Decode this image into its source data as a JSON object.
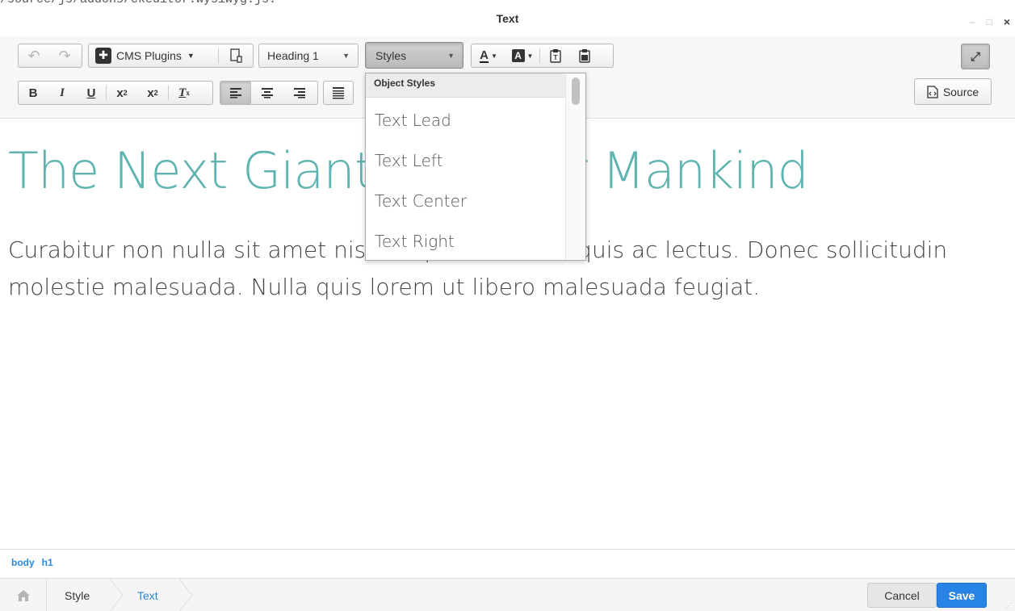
{
  "path_fragment": "/source/js/addons/ckeditor.wysiwyg.js.",
  "window": {
    "title": "Text",
    "minimize_label": "–",
    "restore_label": "□",
    "close_label": "×"
  },
  "toolbar": {
    "cms_plugins_label": "CMS Plugins",
    "format_label": "Heading 1",
    "styles_label": "Styles",
    "source_label": "Source",
    "bold_label": "B",
    "italic_label": "I",
    "underline_label": "U"
  },
  "styles_dropdown": {
    "header": "Object Styles",
    "items": [
      "Text Lead",
      "Text Left",
      "Text Center",
      "Text Right"
    ]
  },
  "content": {
    "heading": "The Next Giant Leap for Mankind",
    "paragraph": "Curabitur non nulla sit amet nisl tempus convallis quis ac lectus. Donec sollicitudin molestie malesuada. Nulla quis lorem ut libero malesuada feugiat."
  },
  "element_path": [
    "body",
    "h1"
  ],
  "breadcrumbs": {
    "style": "Style",
    "text": "Text"
  },
  "actions": {
    "cancel": "Cancel",
    "save": "Save"
  }
}
